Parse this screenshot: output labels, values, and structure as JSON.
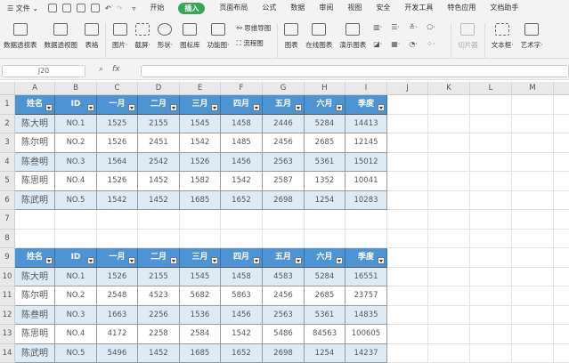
{
  "menu": {
    "file": "文件",
    "tabs": [
      "开始",
      "插入",
      "页面布局",
      "公式",
      "数据",
      "审阅",
      "视图",
      "安全",
      "开发工具",
      "特色应用",
      "文档助手"
    ],
    "active_tab": "插入"
  },
  "ribbon": {
    "pivot_table": "数据透视表",
    "pivot_chart": "数据透视图",
    "table": "表格",
    "picture": "图片·",
    "screenshot": "截屏·",
    "shapes": "形状·",
    "icon_lib": "图标库",
    "func_chart": "功能图·",
    "mindmap": "思维导图",
    "flowchart": "流程图",
    "chart": "图表",
    "online_chart": "在线图表",
    "demo_chart": "演示图表",
    "slicer": "切片器",
    "textbox": "文本框·",
    "wordart": "艺术字·"
  },
  "formula_bar": {
    "name_box": "J20",
    "fx": "fx",
    "value": ""
  },
  "columns": [
    "A",
    "B",
    "C",
    "D",
    "E",
    "F",
    "G",
    "H",
    "I",
    "J",
    "K",
    "L",
    "M"
  ],
  "header_row": [
    "姓名",
    "ID",
    "一月",
    "二月",
    "三月",
    "四月",
    "五月",
    "六月",
    "季度"
  ],
  "table1": [
    [
      "陈大明",
      "NO.1",
      "1525",
      "2155",
      "1545",
      "1458",
      "2446",
      "5284",
      "14413"
    ],
    [
      "陈尔明",
      "NO.2",
      "1526",
      "2451",
      "1542",
      "1485",
      "2456",
      "2685",
      "12145"
    ],
    [
      "陈叁明",
      "NO.3",
      "1564",
      "2542",
      "1526",
      "1456",
      "2563",
      "5361",
      "15012"
    ],
    [
      "陈思明",
      "NO.4",
      "1526",
      "1452",
      "1582",
      "1542",
      "2587",
      "1352",
      "10041"
    ],
    [
      "陈武明",
      "NO.5",
      "1542",
      "1452",
      "1685",
      "1652",
      "2698",
      "1254",
      "10283"
    ]
  ],
  "table2": [
    [
      "陈大明",
      "NO.1",
      "1526",
      "2155",
      "1545",
      "1458",
      "4583",
      "5284",
      "16551"
    ],
    [
      "陈尔明",
      "NO.2",
      "2548",
      "4523",
      "5682",
      "5863",
      "2456",
      "2685",
      "23757"
    ],
    [
      "陈叁明",
      "NO.3",
      "1663",
      "2256",
      "1536",
      "1456",
      "2563",
      "5361",
      "14835"
    ],
    [
      "陈思明",
      "NO.4",
      "4172",
      "2258",
      "2584",
      "1542",
      "5486",
      "84563",
      "100605"
    ],
    [
      "陈武明",
      "NO.5",
      "5496",
      "1452",
      "1685",
      "1652",
      "2698",
      "1254",
      "14237"
    ]
  ],
  "colors": {
    "header": "#4f94d2",
    "band": "#ddebf7",
    "active_tab": "#3aa45a"
  }
}
